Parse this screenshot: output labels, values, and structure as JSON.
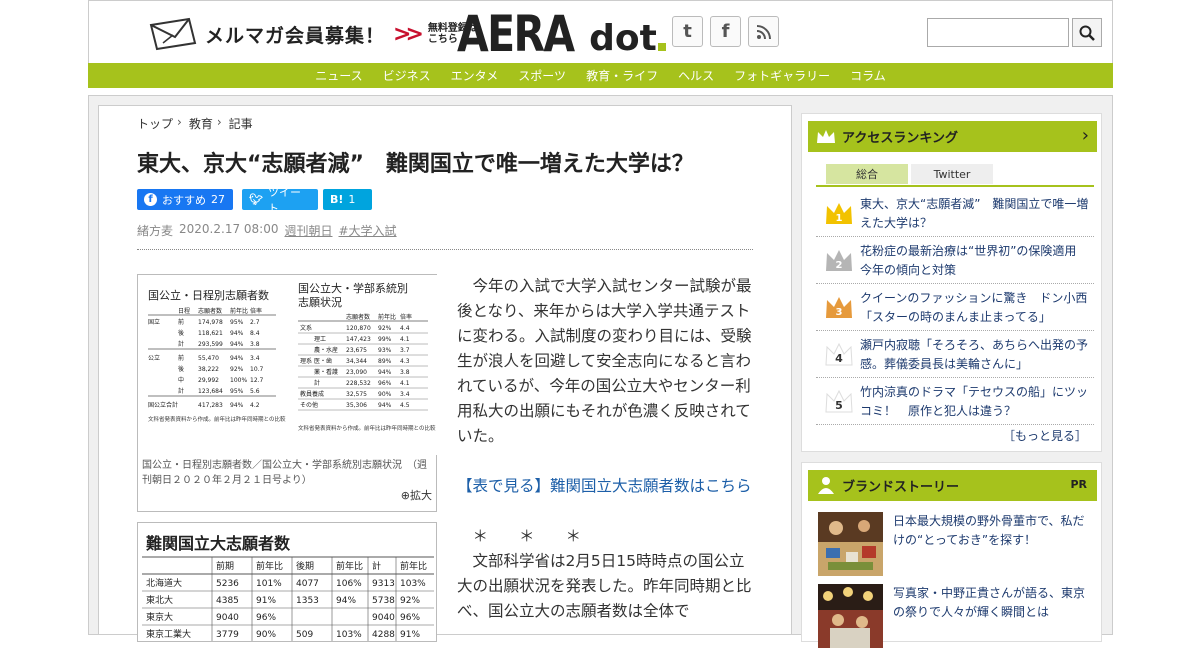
{
  "header": {
    "mailmag_label": "メルマガ会員募集！",
    "mailmag_register_line1": "無料登録は",
    "mailmag_register_line2": "こちら",
    "logo_main": "AERA",
    "logo_sub": "dot",
    "search_placeholder": ""
  },
  "nav": [
    "ニュース",
    "ビジネス",
    "エンタメ",
    "スポーツ",
    "教育・ライフ",
    "ヘルス",
    "フォトギャラリー",
    "コラム"
  ],
  "breadcrumb": {
    "top": "トップ",
    "education": "教育",
    "article": "記事"
  },
  "article": {
    "title": "東大、京大“志願者減”　難関国立で唯一増えた大学は？",
    "recommend_label": "おすすめ",
    "recommend_count": "27",
    "tweet_label": "ツイート",
    "hatena_label": "B!",
    "hatena_count": "1",
    "author": "緒方麦",
    "date": "2020.2.17 08:00",
    "source": "週刊朝日",
    "tag": "#大学入試",
    "figure1_caption": "国公立・日程別志願者数／国公立大・学部系統別志願状況　（週刊朝日２０２０年２月２１日号より）",
    "figure1_zoom": "拡大",
    "paragraph1": "今年の入試で大学入試センター試験が最後となり、来年からは大学入学共通テストに変わる。入試制度の変わり目には、受験生が浪人を回避して安全志向になると言われているが、今年の国公立大やセンター利用私大の出願にもそれが色濃く反映されていた。",
    "link_text": "【表で見る】難関国立大志願者数はこちら",
    "separator": "＊　　＊　　＊",
    "paragraph2": "文部科学省は2月5日15時時点の国公立大の出願状況を発表した。昨年同時期と比べ、国公立大の志願者数は全体で"
  },
  "figure1": {
    "left_title": "国公立・日程別志願者数",
    "left_header": [
      "日程",
      "志願者数",
      "前年比",
      "倍率"
    ],
    "left_rows": [
      [
        "国立",
        "前",
        "174,978",
        "95%",
        "2.7"
      ],
      [
        "",
        "後",
        "118,621",
        "94%",
        "8.4"
      ],
      [
        "",
        "計",
        "293,599",
        "94%",
        "3.8"
      ],
      [
        "公立",
        "前",
        "55,470",
        "94%",
        "3.4"
      ],
      [
        "",
        "後",
        "38,222",
        "92%",
        "10.7"
      ],
      [
        "",
        "中",
        "29,992",
        "100%",
        "12.7"
      ],
      [
        "",
        "計",
        "123,684",
        "95%",
        "5.6"
      ],
      [
        "国公立合計",
        "",
        "417,283",
        "94%",
        "4.2"
      ]
    ],
    "left_note": "文科省発表資料から作成。前年比は昨年同時期との比較",
    "right_title_line1": "国公立大・学部系統別",
    "right_title_line2": "志願状況",
    "right_header": [
      "",
      "志願者数",
      "前年比",
      "倍率"
    ],
    "right_rows": [
      [
        "文系",
        "120,870",
        "92%",
        "4.4"
      ],
      [
        "理工",
        "147,423",
        "99%",
        "4.1"
      ],
      [
        "農・水産",
        "23,675",
        "93%",
        "3.7"
      ],
      [
        "医・歯",
        "34,344",
        "89%",
        "4.3"
      ],
      [
        "薬・看護",
        "23,090",
        "94%",
        "3.8"
      ],
      [
        "計",
        "228,532",
        "96%",
        "4.1"
      ],
      [
        "教員養成",
        "32,575",
        "90%",
        "3.4"
      ],
      [
        "その他",
        "35,306",
        "94%",
        "4.5"
      ]
    ],
    "right_group": "理系",
    "right_note": "文科省発表資料から作成。前年比は昨年同時期との比較"
  },
  "figure2": {
    "title": "難関国立大志願者数",
    "header": [
      "",
      "前期",
      "前年比",
      "後期",
      "前年比",
      "計",
      "前年比"
    ],
    "rows": [
      [
        "北海道大",
        "5236",
        "101%",
        "4077",
        "106%",
        "9313",
        "103%"
      ],
      [
        "東北大",
        "4385",
        "91%",
        "1353",
        "94%",
        "5738",
        "92%"
      ],
      [
        "東京大",
        "9040",
        "96%",
        "",
        "",
        "9040",
        "96%"
      ],
      [
        "東京工業大",
        "3779",
        "90%",
        "509",
        "103%",
        "4288",
        "91%"
      ]
    ]
  },
  "sidebar": {
    "ranking_title": "アクセスランキング",
    "tab_all": "総合",
    "tab_twitter": "Twitter",
    "ranking": [
      {
        "rank": "1",
        "text": "東大、京大“志願者減”　難関国立で唯一増えた大学は？"
      },
      {
        "rank": "2",
        "text": "花粉症の最新治療は“世界初”の保険適用　今年の傾向と対策"
      },
      {
        "rank": "3",
        "text": "クイーンのファッションに驚き　ドン小西「スターの時のまんま止まってる」"
      },
      {
        "rank": "4",
        "text": "瀬戸内寂聴「そろそろ、あちらへ出発の予感。葬儀委員長は美輪さんに」"
      },
      {
        "rank": "5",
        "text": "竹内涼真のドラマ「テセウスの船」にツッコミ！　原作と犯人は違う？"
      }
    ],
    "more": "［もっと見る］",
    "brand_title": "ブランドストーリー",
    "brand_pr": "PR",
    "brand_items": [
      {
        "text": "日本最大規模の野外骨董市で、私だけの“とっておき”を探す！"
      },
      {
        "text": "写真家・中野正貴さんが語る、東京の祭りで人々が輝く瞬間とは"
      }
    ]
  },
  "colors": {
    "accent": "#a6c21c",
    "facebook": "#1877f2",
    "twitter": "#1da1f2",
    "hatena": "#00a4de",
    "link": "#1d5fa8"
  }
}
